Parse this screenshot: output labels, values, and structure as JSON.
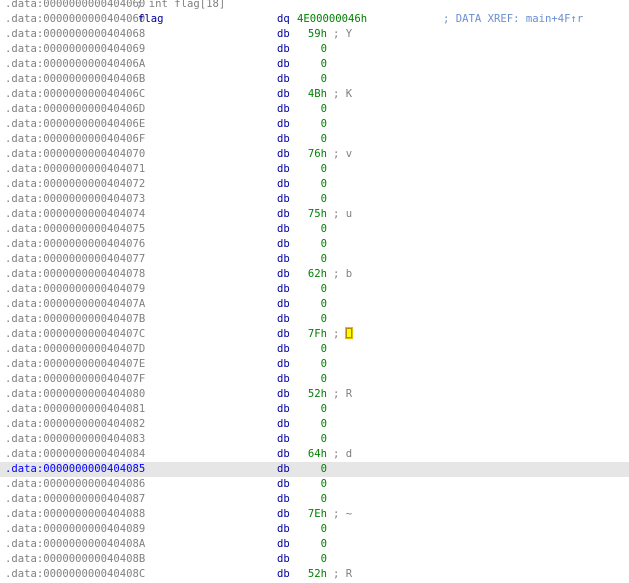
{
  "listing": {
    "header": {
      "address": ".data:0000000000404060",
      "comment": "; int flag[18]"
    },
    "symbol_row": {
      "address": ".data:0000000000404060",
      "name": "flag",
      "mnemonic": "dq",
      "value": "4E00000046h",
      "xref": "; DATA XREF: main+4F↑r"
    },
    "rows": [
      {
        "address": ".data:0000000000404068",
        "mnemonic": "db",
        "value": "59h",
        "comment": "; Y"
      },
      {
        "address": ".data:0000000000404069",
        "mnemonic": "db",
        "value": "0",
        "comment": ""
      },
      {
        "address": ".data:000000000040406A",
        "mnemonic": "db",
        "value": "0",
        "comment": ""
      },
      {
        "address": ".data:000000000040406B",
        "mnemonic": "db",
        "value": "0",
        "comment": ""
      },
      {
        "address": ".data:000000000040406C",
        "mnemonic": "db",
        "value": "4Bh",
        "comment": "; K"
      },
      {
        "address": ".data:000000000040406D",
        "mnemonic": "db",
        "value": "0",
        "comment": ""
      },
      {
        "address": ".data:000000000040406E",
        "mnemonic": "db",
        "value": "0",
        "comment": ""
      },
      {
        "address": ".data:000000000040406F",
        "mnemonic": "db",
        "value": "0",
        "comment": ""
      },
      {
        "address": ".data:0000000000404070",
        "mnemonic": "db",
        "value": "76h",
        "comment": "; v"
      },
      {
        "address": ".data:0000000000404071",
        "mnemonic": "db",
        "value": "0",
        "comment": ""
      },
      {
        "address": ".data:0000000000404072",
        "mnemonic": "db",
        "value": "0",
        "comment": ""
      },
      {
        "address": ".data:0000000000404073",
        "mnemonic": "db",
        "value": "0",
        "comment": ""
      },
      {
        "address": ".data:0000000000404074",
        "mnemonic": "db",
        "value": "75h",
        "comment": "; u"
      },
      {
        "address": ".data:0000000000404075",
        "mnemonic": "db",
        "value": "0",
        "comment": ""
      },
      {
        "address": ".data:0000000000404076",
        "mnemonic": "db",
        "value": "0",
        "comment": ""
      },
      {
        "address": ".data:0000000000404077",
        "mnemonic": "db",
        "value": "0",
        "comment": ""
      },
      {
        "address": ".data:0000000000404078",
        "mnemonic": "db",
        "value": "62h",
        "comment": "; b"
      },
      {
        "address": ".data:0000000000404079",
        "mnemonic": "db",
        "value": "0",
        "comment": ""
      },
      {
        "address": ".data:000000000040407A",
        "mnemonic": "db",
        "value": "0",
        "comment": ""
      },
      {
        "address": ".data:000000000040407B",
        "mnemonic": "db",
        "value": "0",
        "comment": ""
      },
      {
        "address": ".data:000000000040407C",
        "mnemonic": "db",
        "value": "7Fh",
        "comment": "; ",
        "comment_glyph": ""
      },
      {
        "address": ".data:000000000040407D",
        "mnemonic": "db",
        "value": "0",
        "comment": ""
      },
      {
        "address": ".data:000000000040407E",
        "mnemonic": "db",
        "value": "0",
        "comment": ""
      },
      {
        "address": ".data:000000000040407F",
        "mnemonic": "db",
        "value": "0",
        "comment": ""
      },
      {
        "address": ".data:0000000000404080",
        "mnemonic": "db",
        "value": "52h",
        "comment": "; R"
      },
      {
        "address": ".data:0000000000404081",
        "mnemonic": "db",
        "value": "0",
        "comment": ""
      },
      {
        "address": ".data:0000000000404082",
        "mnemonic": "db",
        "value": "0",
        "comment": ""
      },
      {
        "address": ".data:0000000000404083",
        "mnemonic": "db",
        "value": "0",
        "comment": ""
      },
      {
        "address": ".data:0000000000404084",
        "mnemonic": "db",
        "value": "64h",
        "comment": "; d"
      },
      {
        "address": ".data:0000000000404085",
        "mnemonic": "db",
        "value": "0",
        "comment": "",
        "highlighted": true
      },
      {
        "address": ".data:0000000000404086",
        "mnemonic": "db",
        "value": "0",
        "comment": ""
      },
      {
        "address": ".data:0000000000404087",
        "mnemonic": "db",
        "value": "0",
        "comment": ""
      },
      {
        "address": ".data:0000000000404088",
        "mnemonic": "db",
        "value": "7Eh",
        "comment": "; ~"
      },
      {
        "address": ".data:0000000000404089",
        "mnemonic": "db",
        "value": "0",
        "comment": ""
      },
      {
        "address": ".data:000000000040408A",
        "mnemonic": "db",
        "value": "0",
        "comment": ""
      },
      {
        "address": ".data:000000000040408B",
        "mnemonic": "db",
        "value": "0",
        "comment": ""
      },
      {
        "address": ".data:000000000040408C",
        "mnemonic": "db",
        "value": "52h",
        "comment": "; R"
      }
    ]
  }
}
